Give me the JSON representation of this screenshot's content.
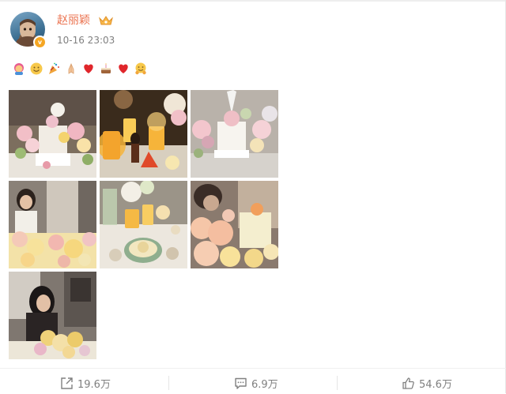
{
  "post": {
    "author": "赵丽颖",
    "timestamp": "10-16 23:03",
    "emoji": [
      "girl-emoji",
      "smile-emoji",
      "party-popper-emoji",
      "pray-emoji",
      "red-heart-emoji",
      "cake-emoji",
      "red-heart-emoji",
      "hug-emoji"
    ],
    "photos": [
      "birthday-cake-flowers-photo",
      "candles-figurine-photo",
      "white-cake-flowers-photo",
      "girl-with-flowers-photo",
      "table-setting-photo",
      "peach-roses-cake-photo",
      "woman-with-bouquet-photo"
    ]
  },
  "actions": {
    "repost_count": "19.6万",
    "comment_count": "6.9万",
    "like_count": "54.6万"
  },
  "colors": {
    "username": "#eb7350",
    "meta": "#808080",
    "vip_badge": "#f5a623"
  }
}
